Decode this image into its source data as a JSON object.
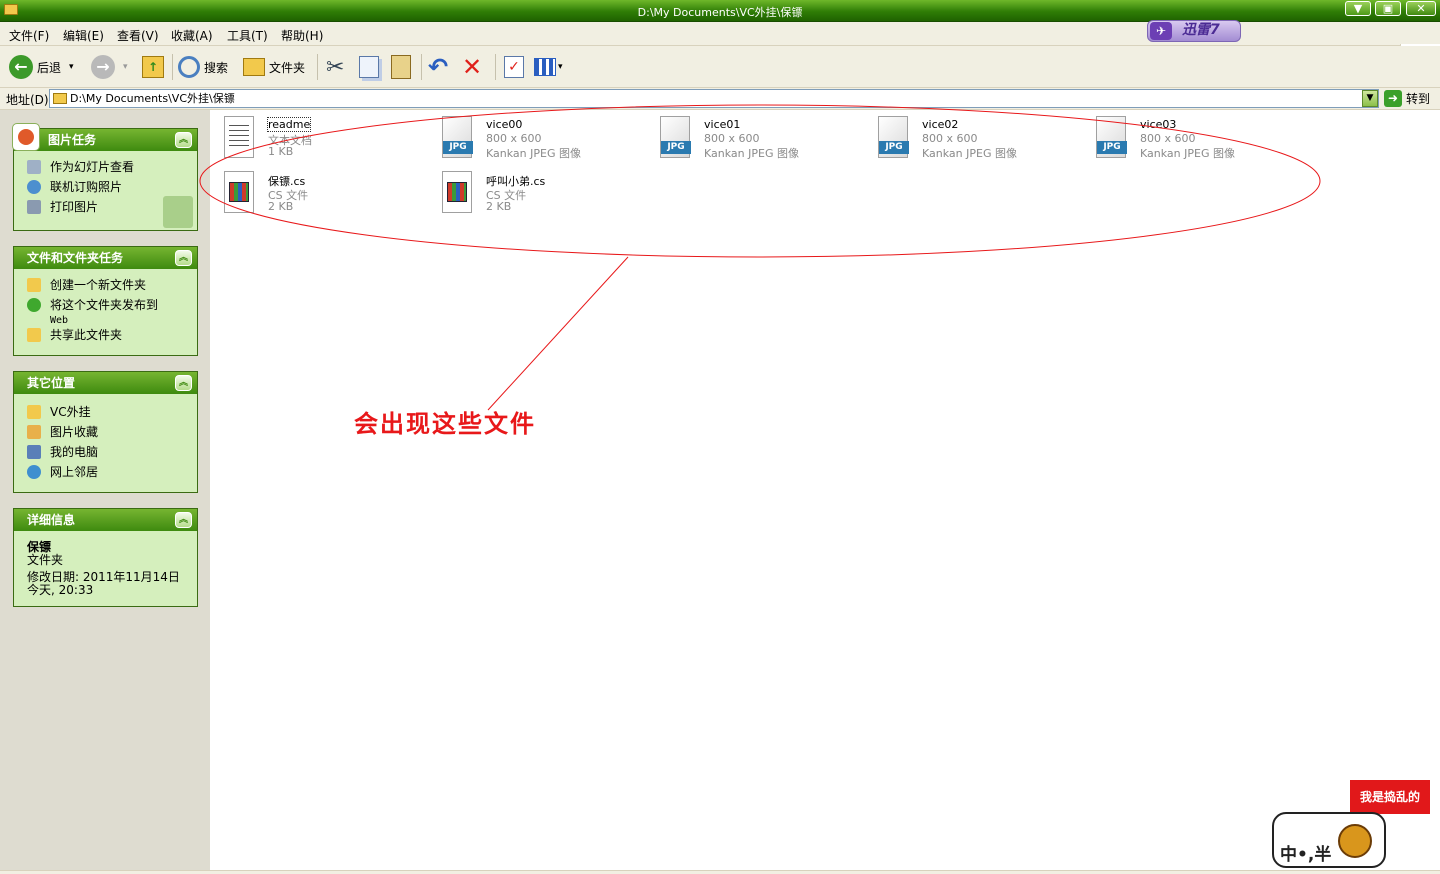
{
  "window": {
    "title": "D:\\My Documents\\VC外挂\\保镖",
    "minimize": "▼",
    "maximize": "▣",
    "close": "✕"
  },
  "menu": [
    "文件(F)",
    "编辑(E)",
    "查看(V)",
    "收藏(A)",
    "工具(T)",
    "帮助(H)"
  ],
  "xunlei_badge": "迅雷7",
  "toolbar": {
    "back_label": "后退",
    "search_label": "搜索",
    "folders_label": "文件夹"
  },
  "address": {
    "label": "地址(D)",
    "value": "D:\\My Documents\\VC外挂\\保镖",
    "go_label": "转到"
  },
  "panels": {
    "picture_tasks": {
      "title": "图片任务",
      "items": [
        "作为幻灯片查看",
        "联机订购照片",
        "打印图片"
      ]
    },
    "file_tasks": {
      "title": "文件和文件夹任务",
      "items": [
        "创建一个新文件夹",
        "将这个文件夹发布到",
        "Web",
        "共享此文件夹"
      ]
    },
    "other_places": {
      "title": "其它位置",
      "items": [
        "VC外挂",
        "图片收藏",
        "我的电脑",
        "网上邻居"
      ]
    },
    "details": {
      "title": "详细信息",
      "name": "保镖",
      "type": "文件夹",
      "modified_label": "修改日期: 2011年11月14日",
      "modified_time": "今天, 20:33"
    }
  },
  "files": [
    {
      "name": "readme",
      "line1": "文本文档",
      "line2": "1 KB",
      "kind": "text"
    },
    {
      "name": "vice00",
      "line1": "800 x 600",
      "line2": "Kankan JPEG 图像",
      "kind": "jpg"
    },
    {
      "name": "vice01",
      "line1": "800 x 600",
      "line2": "Kankan JPEG 图像",
      "kind": "jpg"
    },
    {
      "name": "vice02",
      "line1": "800 x 600",
      "line2": "Kankan JPEG 图像",
      "kind": "jpg"
    },
    {
      "name": "vice03",
      "line1": "800 x 600",
      "line2": "Kankan JPEG 图像",
      "kind": "jpg"
    },
    {
      "name": "保镖.cs",
      "line1": "CS 文件",
      "line2": "2 KB",
      "kind": "cs"
    },
    {
      "name": "呼叫小弟.cs",
      "line1": "CS 文件",
      "line2": "2 KB",
      "kind": "cs"
    }
  ],
  "jpg_tag": "JPG",
  "annotation": "会出现这些文件",
  "watermark": {
    "flag_text": "我是捣乱的",
    "badge_text": "中•,半"
  },
  "colors": {
    "titlebar": "#2f7d06",
    "panel_header": "#3e8a0f",
    "panel_body": "#d5efbd",
    "annotation": "#e8181a"
  }
}
